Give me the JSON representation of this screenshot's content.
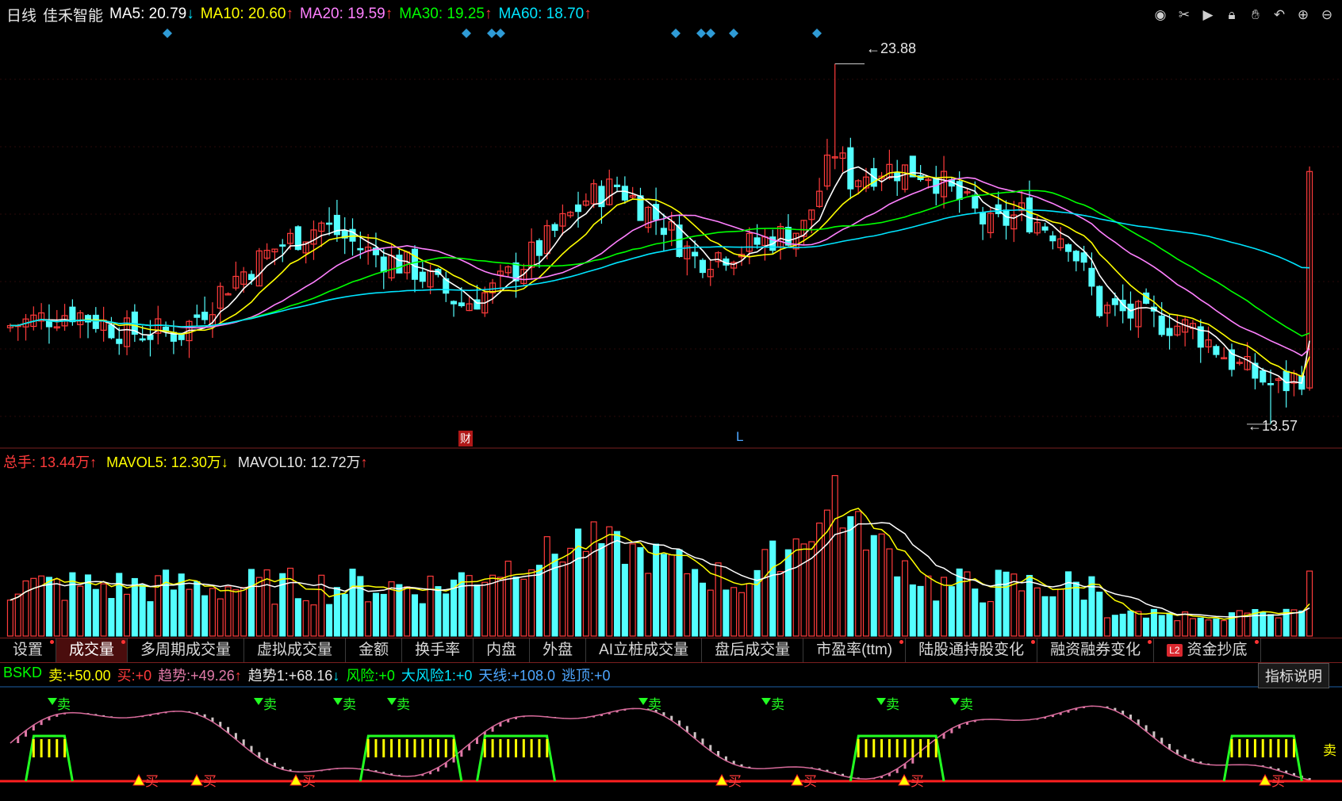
{
  "header": {
    "period": "日线",
    "stock_name": "佳禾智能",
    "ma": [
      {
        "label": "MA5:",
        "value": "20.79",
        "arrow": "↓",
        "color": "#ffffff"
      },
      {
        "label": "MA10:",
        "value": "20.60",
        "arrow": "↑",
        "color": "#ffff00"
      },
      {
        "label": "MA20:",
        "value": "19.59",
        "arrow": "↑",
        "color": "#ff80ff"
      },
      {
        "label": "MA30:",
        "value": "19.25",
        "arrow": "↑",
        "color": "#00ff00"
      },
      {
        "label": "MA60:",
        "value": "18.70",
        "arrow": "↑",
        "color": "#00e5ff"
      }
    ]
  },
  "toolbar_icons": [
    "eye-icon",
    "scissors-icon",
    "play-icon",
    "lock-icon",
    "hand-icon",
    "undo-icon",
    "zoom-in-icon",
    "zoom-out-icon"
  ],
  "price_chart": {
    "high_label": "23.88",
    "low_label": "13.57",
    "marker_cai": "财",
    "marker_l": "L",
    "ylim": [
      13.0,
      24.8
    ]
  },
  "volume": {
    "total_label": "总手:",
    "total_value": "13.44万",
    "total_arrow": "↑",
    "mavol5_label": "MAVOL5:",
    "mavol5_value": "12.30万",
    "mavol5_arrow": "↓",
    "mavol10_label": "MAVOL10:",
    "mavol10_value": "12.72万",
    "mavol10_arrow": "↑"
  },
  "tabs": [
    {
      "label": "设置",
      "dot": true
    },
    {
      "label": "成交量",
      "dot": true,
      "active": true
    },
    {
      "label": "多周期成交量",
      "dot": false
    },
    {
      "label": "虚拟成交量",
      "dot": false
    },
    {
      "label": "金额",
      "dot": false
    },
    {
      "label": "换手率",
      "dot": false
    },
    {
      "label": "内盘",
      "dot": false
    },
    {
      "label": "外盘",
      "dot": false
    },
    {
      "label": "AI立桩成交量",
      "dot": false
    },
    {
      "label": "盘后成交量",
      "dot": false
    },
    {
      "label": "市盈率(ttm)",
      "dot": true
    },
    {
      "label": "陆股通持股变化",
      "dot": true
    },
    {
      "label": "融资融券变化",
      "dot": true
    },
    {
      "label": "资金抄底",
      "dot": true,
      "badge": "L2"
    }
  ],
  "indicator": {
    "name": "BSKD",
    "fields": [
      {
        "label": "卖:",
        "value": "+50.00",
        "color": "#ffff00",
        "lcolor": "#ffff00"
      },
      {
        "label": "买:",
        "value": "+0",
        "color": "#ff3b3b",
        "lcolor": "#ff3b3b"
      },
      {
        "label": "趋势:",
        "value": "+49.26",
        "arrow": "↑",
        "color": "#e07aa8",
        "lcolor": "#e07aa8"
      },
      {
        "label": "趋势1:",
        "value": "+68.16",
        "arrow": "↓",
        "color": "#e6e6e6",
        "lcolor": "#e6e6e6"
      },
      {
        "label": "风险:",
        "value": "+0",
        "color": "#00ff00",
        "lcolor": "#00ff00"
      },
      {
        "label": "大风险1:",
        "value": "+0",
        "color": "#00e5ff",
        "lcolor": "#00e5ff"
      },
      {
        "label": "天线:",
        "value": "+108.0",
        "color": "#4da6ff",
        "lcolor": "#4da6ff"
      },
      {
        "label": "逃顶:",
        "value": "+0",
        "color": "#4da6ff",
        "lcolor": "#4da6ff"
      }
    ],
    "explain_button": "指标说明",
    "sell_text": "卖",
    "buy_text": "买"
  },
  "colors": {
    "up": "#ff3b3b",
    "down": "#54ffff",
    "ma5": "#ffffff",
    "ma10": "#ffff00",
    "ma20": "#ff80ff",
    "ma30": "#00ff00",
    "ma60": "#00e5ff",
    "diamond": "#2f9bd6"
  }
}
